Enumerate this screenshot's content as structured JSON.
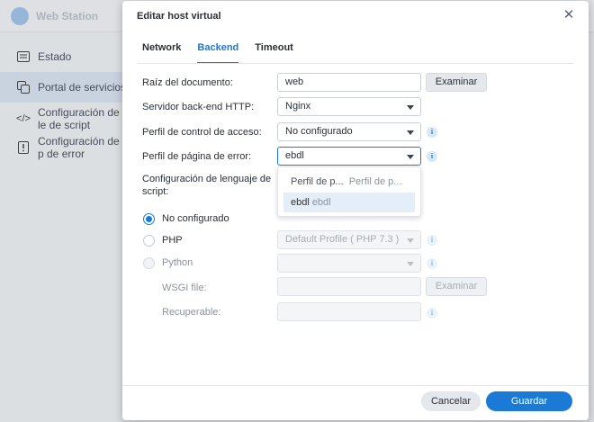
{
  "app": {
    "title": "Web Station"
  },
  "sidebar": {
    "items": [
      {
        "label": "Estado",
        "icon": "status-list-icon"
      },
      {
        "label": "Portal de servicios",
        "icon": "portal-icon"
      },
      {
        "label": "Configuración de le de script",
        "icon": "code-icon"
      },
      {
        "label": "Configuración de p de error",
        "icon": "error-page-icon"
      }
    ]
  },
  "modal": {
    "title": "Editar host virtual",
    "close_icon": "close-icon",
    "tabs": [
      "Network",
      "Backend",
      "Timeout"
    ],
    "active_tab": "Backend",
    "document_root": {
      "label": "Raíz del documento:",
      "value": "web",
      "button": "Examinar"
    },
    "backend_server": {
      "label": "Servidor back-end HTTP:",
      "value": "Nginx"
    },
    "access_profile": {
      "label": "Perfil de control de acceso:",
      "value": "No configurado"
    },
    "error_profile": {
      "label": "Perfil de página de error:",
      "value": "ebdl",
      "options": [
        {
          "label": "Perfil de p...",
          "sub": "Perfil de p..."
        },
        {
          "label": "ebdl",
          "sub": "ebdl"
        }
      ],
      "selected_index": 1
    },
    "script_language": {
      "label": "Configuración de lenguaje de script:",
      "options": [
        "No configurado",
        "PHP",
        "Python"
      ],
      "selected": "No configurado",
      "php_profile": "Default Profile ( PHP 7.3 )",
      "wsgi_label": "WSGI file:",
      "wsgi_button": "Examinar",
      "recuperable_label": "Recuperable:"
    },
    "footer": {
      "cancel": "Cancelar",
      "save": "Guardar"
    }
  },
  "colors": {
    "accent": "#1b7ad6",
    "selected_option": "#e3eef9"
  }
}
